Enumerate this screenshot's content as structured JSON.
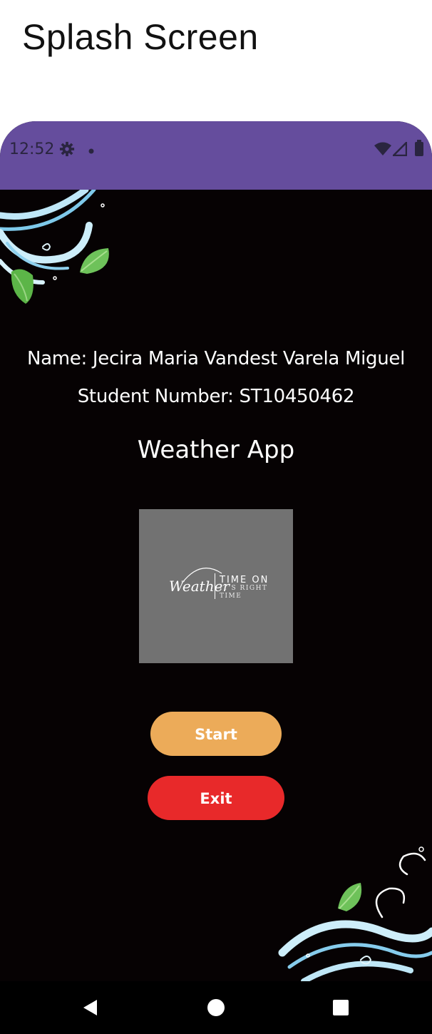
{
  "caption": "Splash Screen",
  "status_bar": {
    "time": "12:52",
    "icons": [
      "settings-icon",
      "notification-dot-icon",
      "wifi-icon",
      "signal-icon",
      "battery-icon"
    ],
    "color": "#654d9d"
  },
  "profile": {
    "name_line": "Name: Jecira Maria Vandest Varela Miguel",
    "student_number_line": "Student Number: ST10450462"
  },
  "app": {
    "title": "Weather App"
  },
  "logo": {
    "script_text": "Weather",
    "line1": "TIME ON",
    "line2": "IT'S RIGHT",
    "line3": "TIME",
    "background": "#727272"
  },
  "buttons": {
    "start_label": "Start",
    "start_color": "#ecab59",
    "exit_label": "Exit",
    "exit_color": "#e8292a"
  },
  "nav_bar": {
    "icons": [
      "back-icon",
      "home-icon",
      "recents-icon"
    ]
  },
  "colors": {
    "background": "#060203",
    "text": "#ffffff"
  }
}
